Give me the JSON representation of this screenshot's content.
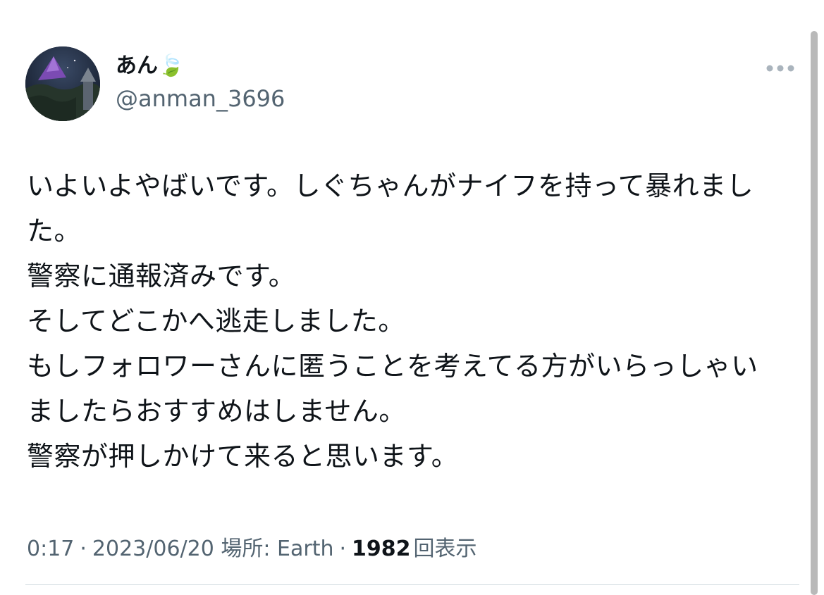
{
  "user": {
    "display_name": "あん🍃",
    "handle": "@anman_3696",
    "avatar_icon": "avatar-night-mountain-icon"
  },
  "menu": {
    "more_icon": "ellipsis-icon"
  },
  "tweet": {
    "lines": [
      "いよいよやばいです。しぐちゃんがナイフを持って暴れまし",
      "た。",
      "警察に通報済みです。",
      "そしてどこかへ逃走しました。",
      "もしフォロワーさんに匿うことを考えてる方がいらっしゃい",
      "ましたらおすすめはしません。",
      "警察が押しかけて来ると思います。"
    ]
  },
  "meta": {
    "time": "0:17",
    "date": "2023/06/20",
    "location_label": "場所: Earth",
    "separator": "·",
    "views_count": "1982",
    "views_label": "回表示"
  },
  "colors": {
    "text_primary": "#0f1419",
    "text_secondary": "#536471",
    "divider": "#cfd9de",
    "scrollbar": "#b9b9b9"
  }
}
